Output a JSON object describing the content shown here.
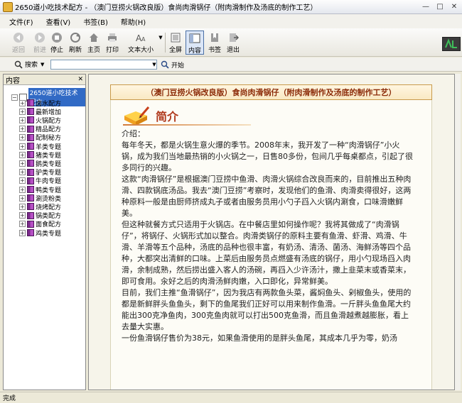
{
  "window": {
    "title": "2650道小吃技术配方 - （澳门豆捞火锅改良版）食尚肉滑锅仔（附肉滑制作及汤底的制作工艺）"
  },
  "menu": [
    "文件(F)",
    "查看(V)",
    "书签(B)",
    "帮助(H)"
  ],
  "toolbar": {
    "back": "返回",
    "forward": "前进",
    "stop": "停止",
    "refresh": "刷新",
    "home": "主页",
    "print": "打印",
    "fontsize": "文本大小",
    "fullscreen": "全屏",
    "content": "内容",
    "bookmark": "书签",
    "exit": "退出"
  },
  "search": {
    "label": "搜索",
    "go": "开始"
  },
  "sidebar": {
    "header": "内容",
    "root": "2650道小吃技术配方",
    "items": [
      "卤水配方",
      "最新增加",
      "火锅配方",
      "精品配方",
      "配制秘方",
      "羊类专题",
      "猪类专题",
      "鹅类专题",
      "驴类专题",
      "牛肉专题",
      "鸭类专题",
      "涮烫粉类",
      "烧烤配方",
      "锅类配方",
      "面食配方",
      "鸡类专题"
    ]
  },
  "article": {
    "header": "（澳门豆捞火锅改良版）食尚肉滑锅仔（附肉滑制作及汤底的制作工艺）",
    "section_title": "简介",
    "intro_label": "介绍：",
    "paragraphs": [
      "每年冬天，都是火锅生意火爆的季节。2008年末，我开发了一种“肉滑锅仔”小火锅，成为我们当地最热销的小火锅之一，日售80多份，包间几乎每桌都点，引起了很多同行的兴趣。",
      "这款“肉滑锅仔”是根据澳门豆捞中鱼滑、肉滑火锅综合改良而来的，目前推出五种肉滑、四款锅底汤品。我去“澳门豆捞”考察时，发现他们的鱼滑、肉滑卖得很好，这两种原料一般是由厨师挤成丸子或者由服务员用小勺子舀入火锅内涮食，口味滑嫩鲜美。",
      "但这种就餐方式只适用于火锅店。在中餐店里如何操作呢？我将其做成了“肉滑锅仔”，将锅仔、火锅形式加以整合。肉滑类锅仔的原料主要有鱼滑、虾滑、鸡滑、牛滑、羊滑等五个品种，汤底的品种也很丰富，有奶汤、清汤、菌汤、海鲜汤等四个品种，大都突出清鲜的口味。上菜后由服务员点燃盛有汤底的锅仔，用小勺现场舀入肉滑，余制成熟，然后捞出盛入客人的汤碗，再舀入少许汤汁，撒上韭菜末或香菜末，即可食用。汆好之后的肉滑汤鲜肉嫩，入口即化，异常鲜美。",
      "目前，我们主推“鱼滑锅仔”，因为我店有两款鱼头菜，酱焖鱼头、剁椒鱼头，使用的都是新鲜胖头鱼鱼头，剩下的鱼尾我们正好可以用来制作鱼滑。一斤胖头鱼鱼尾大约能出300克净鱼肉，300克鱼肉就可以打出500克鱼滑，而且鱼滑越煮越膨胀，看上去量大实惠。",
      "一份鱼滑锅仔售价为38元，如果鱼滑使用的是胖头鱼尾，其成本几乎为零，奶汤"
    ]
  },
  "status": "完成"
}
